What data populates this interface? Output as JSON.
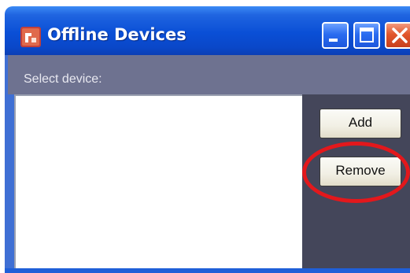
{
  "window": {
    "title": "Offline Devices",
    "title_bar_color": "#0a4fd6",
    "controls": {
      "minimize": "minimize-icon",
      "maximize": "maximize-icon",
      "close": "close-icon"
    }
  },
  "form": {
    "select_label": "Select device:",
    "device_list": []
  },
  "buttons": {
    "add_label": "Add",
    "remove_label": "Remove"
  },
  "annotation": {
    "color": "#e3181c",
    "highlighted": "remove-button"
  }
}
